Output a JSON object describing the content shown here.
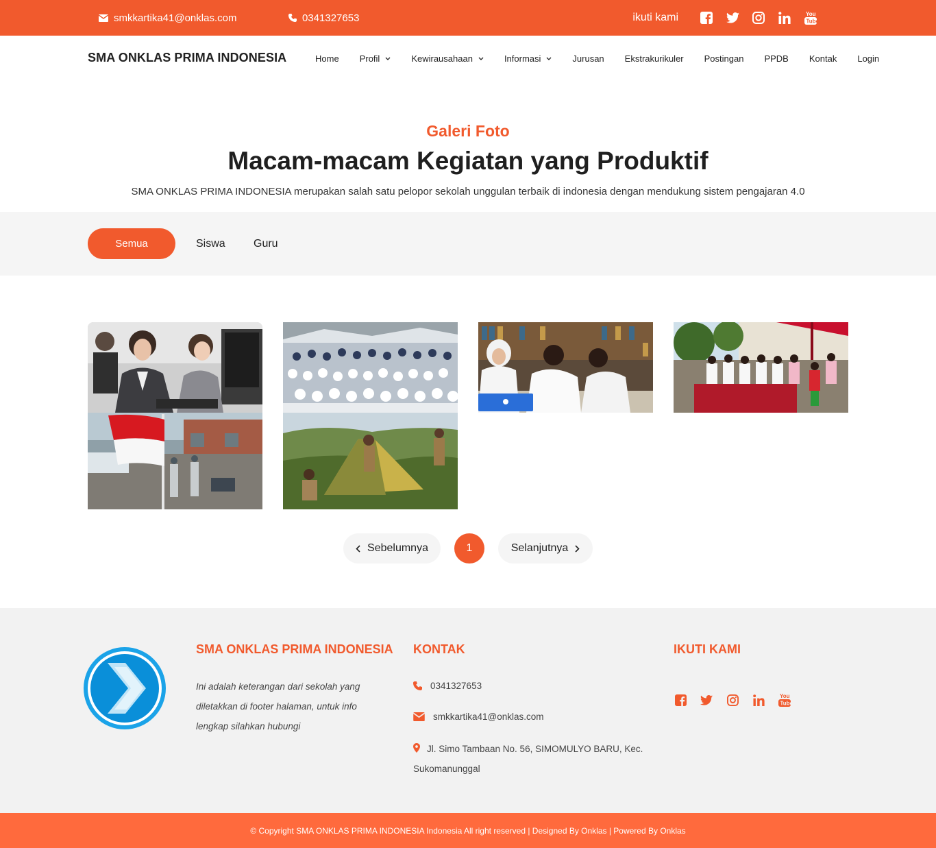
{
  "topbar": {
    "email": "smkkartika41@onklas.com",
    "phone": "0341327653",
    "follow_label": "ikuti kami",
    "social_icons": [
      "facebook-icon",
      "twitter-icon",
      "instagram-icon",
      "linkedin-icon",
      "youtube-icon"
    ]
  },
  "navbar": {
    "brand": "SMA ONKLAS PRIMA INDONESIA",
    "items": [
      {
        "label": "Home",
        "dropdown": false
      },
      {
        "label": "Profil",
        "dropdown": true
      },
      {
        "label": "Kewirausahaan",
        "dropdown": true
      },
      {
        "label": "Informasi",
        "dropdown": true
      },
      {
        "label": "Jurusan",
        "dropdown": false
      },
      {
        "label": "Ekstrakurikuler",
        "dropdown": false
      },
      {
        "label": "Postingan",
        "dropdown": false
      },
      {
        "label": "PPDB",
        "dropdown": false
      },
      {
        "label": "Kontak",
        "dropdown": false
      },
      {
        "label": "Login",
        "dropdown": false
      }
    ]
  },
  "hero": {
    "eyebrow": "Galeri Foto",
    "title": "Macam-macam Kegiatan yang Produktif",
    "description": "SMA ONKLAS PRIMA INDONESIA merupakan salah satu pelopor sekolah unggulan terbaik di indonesia dengan mendukung sistem pengajaran 4.0"
  },
  "filters": {
    "active": "Semua",
    "items": [
      "Semua",
      "Siswa",
      "Guru"
    ]
  },
  "gallery": {
    "photos": [
      "call-center-photo",
      "student-group-photo",
      "study-group-photo",
      "outdoor-event-photo",
      "flag-ceremony-photo",
      "scout-camp-photo"
    ]
  },
  "pagination": {
    "prev_label": "Sebelumnya",
    "current_page": "1",
    "next_label": "Selanjutnya"
  },
  "footer": {
    "school_title": "SMA ONKLAS PRIMA INDONESIA",
    "school_text": "Ini adalah keterangan dari sekolah yang diletakkan di footer halaman, untuk info lengkap silahkan hubungi",
    "contact_title": "KONTAK",
    "phone": "0341327653",
    "email": "smkkartika41@onklas.com",
    "address": "Jl. Simo Tambaan No. 56, SIMOMULYO BARU, Kec. Sukomanunggal",
    "follow_title": "IKUTI KAMI"
  },
  "copyright": "© Copyright SMA ONKLAS PRIMA INDONESIA Indonesia All right reserved | Designed By Onklas | Powered By Onklas",
  "colors": {
    "accent": "#f15a2d",
    "copyright_bar": "#ff6a3d",
    "filter_bg": "#f5f5f5",
    "footer_bg": "#f2f2f2"
  }
}
